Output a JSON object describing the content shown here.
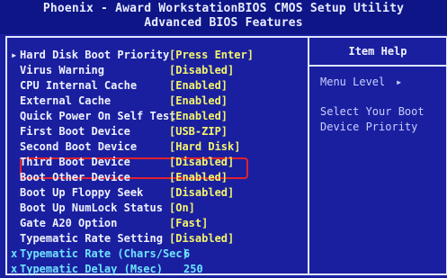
{
  "header": {
    "title_line_1": "Phoenix - Award WorkstationBIOS CMOS Setup Utility",
    "title_line_2": "Advanced BIOS Features"
  },
  "settings": [
    {
      "bullet": "▸",
      "label": "Hard Disk Boot Priority",
      "value": "[Press Enter]"
    },
    {
      "bullet": "",
      "label": "Virus Warning",
      "value": "[Disabled]"
    },
    {
      "bullet": "",
      "label": "CPU Internal Cache",
      "value": "[Enabled]"
    },
    {
      "bullet": "",
      "label": "External Cache",
      "value": "[Enabled]"
    },
    {
      "bullet": "",
      "label": "Quick Power On Self Test",
      "value": "[Enabled]"
    },
    {
      "bullet": "",
      "label": "First Boot Device",
      "value": "[USB-ZIP]"
    },
    {
      "bullet": "",
      "label": "Second Boot Device",
      "value": "[Hard Disk]"
    },
    {
      "bullet": "",
      "label": "Third Boot Device",
      "value": "[Disabled]"
    },
    {
      "bullet": "",
      "label": "Boot Other Device",
      "value": "[Enabled]"
    },
    {
      "bullet": "",
      "label": "Boot Up Floppy Seek",
      "value": "[Disabled]"
    },
    {
      "bullet": "",
      "label": "Boot Up NumLock Status",
      "value": "[On]"
    },
    {
      "bullet": "",
      "label": "Gate A20 Option",
      "value": "[Fast]"
    },
    {
      "bullet": "",
      "label": "Typematic Rate Setting",
      "value": "[Disabled]"
    },
    {
      "bullet": "x",
      "label": "Typematic Rate (Chars/Sec)",
      "value": "6"
    },
    {
      "bullet": "x",
      "label": "Typematic Delay (Msec)",
      "value": "250"
    }
  ],
  "item_help": {
    "title": "Item Help",
    "menu_level_label": "Menu Level",
    "menu_level_arrow": "▸",
    "help_text": "Select Your Boot Device Priority"
  },
  "colors": {
    "background": "#1a1f9f",
    "value_yellow": "#f3f46c",
    "disabled_cyan": "#6ee3ff",
    "highlight_red": "#e0212d"
  }
}
